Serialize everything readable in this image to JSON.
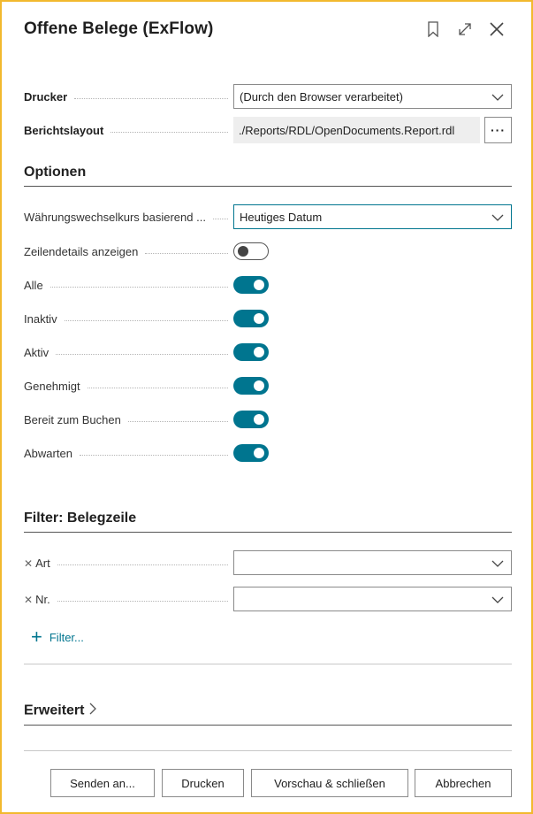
{
  "dialog": {
    "title": "Offene Belege (ExFlow)",
    "icons": [
      "bookmark-icon",
      "expand-icon",
      "close-icon"
    ]
  },
  "printer": {
    "label": "Drucker",
    "value": "(Durch den Browser verarbeitet)"
  },
  "layout": {
    "label": "Berichtslayout",
    "value": "./Reports/RDL/OpenDocuments.Report.rdl",
    "ellipsis": "···"
  },
  "options": {
    "heading": "Optionen",
    "exchange_rate": {
      "label": "Währungswechselkurs basierend ...",
      "value": "Heutiges Datum"
    },
    "toggles": [
      {
        "label": "Zeilendetails anzeigen",
        "on": false
      },
      {
        "label": "Alle",
        "on": true
      },
      {
        "label": "Inaktiv",
        "on": true
      },
      {
        "label": "Aktiv",
        "on": true
      },
      {
        "label": "Genehmigt",
        "on": true
      },
      {
        "label": "Bereit zum Buchen",
        "on": true
      },
      {
        "label": "Abwarten",
        "on": true
      }
    ]
  },
  "filter": {
    "heading": "Filter: Belegzeile",
    "fields": [
      {
        "label": "Art",
        "value": ""
      },
      {
        "label": "Nr.",
        "value": ""
      }
    ],
    "add_label": "Filter..."
  },
  "advanced": {
    "heading": "Erweitert"
  },
  "buttons": {
    "send": "Senden an...",
    "print": "Drucken",
    "preview": "Vorschau & schließen",
    "cancel": "Abbrechen"
  },
  "colors": {
    "accent": "#00758f",
    "frame": "#f2b92e"
  }
}
